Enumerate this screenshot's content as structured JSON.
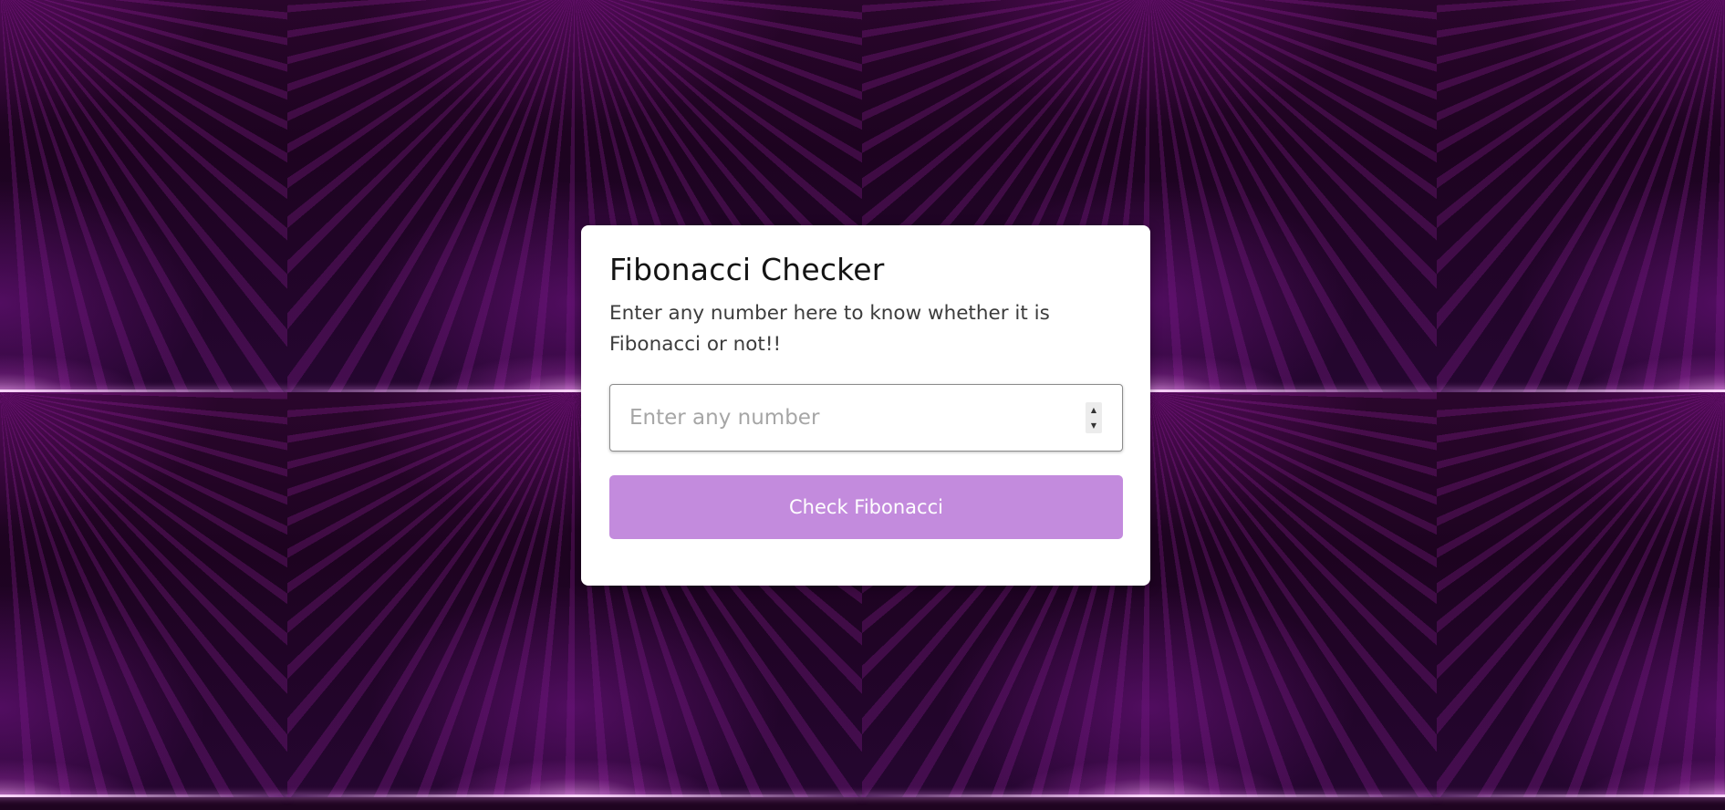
{
  "app": {
    "title": "Fibonacci Checker",
    "description": "Enter any number here to know whether it is Fibonacci or not!!"
  },
  "form": {
    "input": {
      "placeholder": "Enter any number",
      "value": ""
    },
    "stepper": {
      "up_icon": "chevron-up-icon",
      "down_icon": "chevron-down-icon"
    },
    "submit_label": "Check Fibonacci"
  },
  "colors": {
    "background": "#1e0420",
    "card": "#ffffff",
    "button": "#c38bdd",
    "button_text": "#ffffff"
  }
}
